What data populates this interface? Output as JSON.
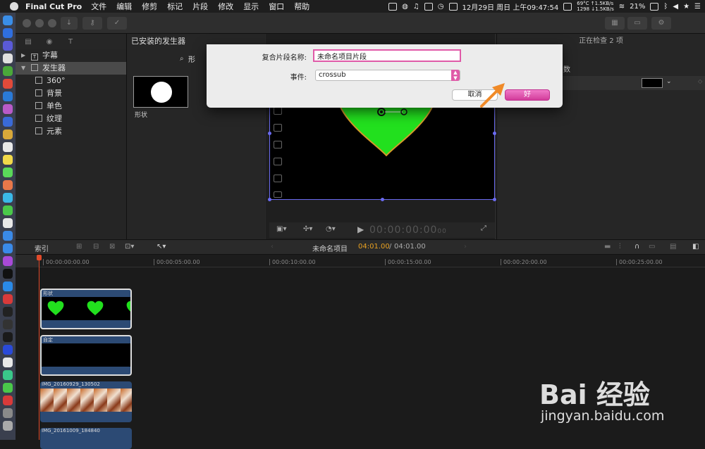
{
  "menubar": {
    "app_name": "Final Cut Pro",
    "items": [
      "文件",
      "编辑",
      "修剪",
      "标记",
      "片段",
      "修改",
      "显示",
      "窗口",
      "帮助"
    ],
    "date_time": "12月29日 周日 上午09:47:54",
    "temp": "69°C",
    "fan": "1298",
    "net_up": "↑1.5KB/s",
    "net_down": "↓1.5KB/s",
    "battery": "21%"
  },
  "sidebar": {
    "items": [
      {
        "label": "字幕",
        "icon": "title-icon"
      },
      {
        "label": "发生器",
        "icon": "generator-icon"
      },
      {
        "label": "360°",
        "icon": "generator-icon"
      },
      {
        "label": "背景",
        "icon": "generator-icon"
      },
      {
        "label": "单色",
        "icon": "generator-icon"
      },
      {
        "label": "纹理",
        "icon": "generator-icon"
      },
      {
        "label": "元素",
        "icon": "generator-icon"
      }
    ]
  },
  "generators": {
    "header": "已安装的发生器",
    "search_fragment": "形",
    "thumb_label": "形状"
  },
  "inspector": {
    "title": "正在检查 2 项",
    "param_fragment": "数"
  },
  "viewer": {
    "timecode": "00:00:00:00",
    "timecode_frames": "00"
  },
  "timeline_toolbar": {
    "index_label": "索引",
    "project_name": "未命名项目",
    "current_time": "04:01.00",
    "separator": "/",
    "total_time": "04:01.00"
  },
  "ruler": [
    "00:00:00:00.00",
    "00:00:05:00.00",
    "00:00:10:00.00",
    "00:00:15:00.00",
    "00:00:20:00.00",
    "00:00:25:00.00"
  ],
  "clips": [
    {
      "name": "形状"
    },
    {
      "name": "自定"
    },
    {
      "name": "IMG_20160929_130502"
    },
    {
      "name": "IMG_20161009_184840"
    }
  ],
  "dialog": {
    "name_label": "复合片段名称:",
    "name_value": "未命名项目片段",
    "event_label": "事件:",
    "event_value": "crossub",
    "cancel_label": "取消",
    "ok_label": "好"
  },
  "watermark": {
    "brand": "Bai 经验",
    "url": "jingyan.baidu.com"
  },
  "colors": {
    "accent": "#e05aa8",
    "heart": "#22e01e",
    "heart_outline": "#d49a2a",
    "playhead": "#e04a2a",
    "timecode_highlight": "#e8a020"
  }
}
